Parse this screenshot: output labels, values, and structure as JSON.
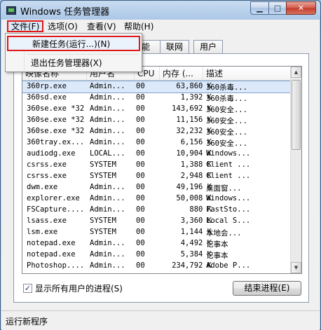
{
  "window": {
    "title": "Windows 任务管理器",
    "minimize_label": "▁",
    "maximize_label": "□",
    "close_label": "✕"
  },
  "menubar": {
    "file": "文件(F)",
    "options": "选项(O)",
    "view": "查看(V)",
    "help": "帮助(H)"
  },
  "file_menu": {
    "new_task": "新建任务(运行...)(N)",
    "exit": "退出任务管理器(X)"
  },
  "tabs": {
    "perf_fragment": "能",
    "network": "联网",
    "users": "用户"
  },
  "table": {
    "columns": {
      "name": "映像名称",
      "user": "用户名",
      "cpu": "CPU",
      "memory": "内存 (...",
      "description": "描述"
    },
    "rows": [
      {
        "name": "360rp.exe",
        "user": "Admin...",
        "cpu": "00",
        "memory": "63,860 K",
        "description": "360杀毒..."
      },
      {
        "name": "360sd.exe",
        "user": "Admin...",
        "cpu": "00",
        "memory": "1,392 K",
        "description": "360杀毒..."
      },
      {
        "name": "360se.exe *32",
        "user": "Admin...",
        "cpu": "00",
        "memory": "143,692 K",
        "description": "360安全..."
      },
      {
        "name": "360se.exe *32",
        "user": "Admin...",
        "cpu": "00",
        "memory": "11,156 K",
        "description": "360安全..."
      },
      {
        "name": "360se.exe *32",
        "user": "Admin...",
        "cpu": "00",
        "memory": "32,232 K",
        "description": "360安全..."
      },
      {
        "name": "360tray.ex...",
        "user": "Admin...",
        "cpu": "00",
        "memory": "6,156 K",
        "description": "360安全..."
      },
      {
        "name": "audiodg.exe",
        "user": "LOCAL...",
        "cpu": "00",
        "memory": "10,904 K",
        "description": "Windows..."
      },
      {
        "name": "csrss.exe",
        "user": "SYSTEM",
        "cpu": "00",
        "memory": "1,388 K",
        "description": "Client ..."
      },
      {
        "name": "csrss.exe",
        "user": "SYSTEM",
        "cpu": "00",
        "memory": "2,948 K",
        "description": "Client ..."
      },
      {
        "name": "dwm.exe",
        "user": "Admin...",
        "cpu": "00",
        "memory": "49,196 K",
        "description": "桌面窗..."
      },
      {
        "name": "explorer.exe",
        "user": "Admin...",
        "cpu": "00",
        "memory": "50,008 K",
        "description": "Windows..."
      },
      {
        "name": "FSCapture....",
        "user": "Admin...",
        "cpu": "00",
        "memory": "880 K",
        "description": "FastSto..."
      },
      {
        "name": "lsass.exe",
        "user": "SYSTEM",
        "cpu": "00",
        "memory": "3,360 K",
        "description": "Local S..."
      },
      {
        "name": "lsm.exe",
        "user": "SYSTEM",
        "cpu": "00",
        "memory": "1,144 K",
        "description": "本地会..."
      },
      {
        "name": "notepad.exe",
        "user": "Admin...",
        "cpu": "00",
        "memory": "4,492 K",
        "description": "记事本"
      },
      {
        "name": "notepad.exe",
        "user": "Admin...",
        "cpu": "00",
        "memory": "5,384 K",
        "description": "记事本"
      },
      {
        "name": "Photoshop....",
        "user": "Admin...",
        "cpu": "00",
        "memory": "234,792 K",
        "description": "Adobe P..."
      }
    ]
  },
  "show_all_users": {
    "checked": true,
    "check_glyph": "✓",
    "label": "显示所有用户的进程(S)"
  },
  "end_process_button": "结束进程(E)",
  "statusbar": {
    "text": "运行新程序"
  }
}
